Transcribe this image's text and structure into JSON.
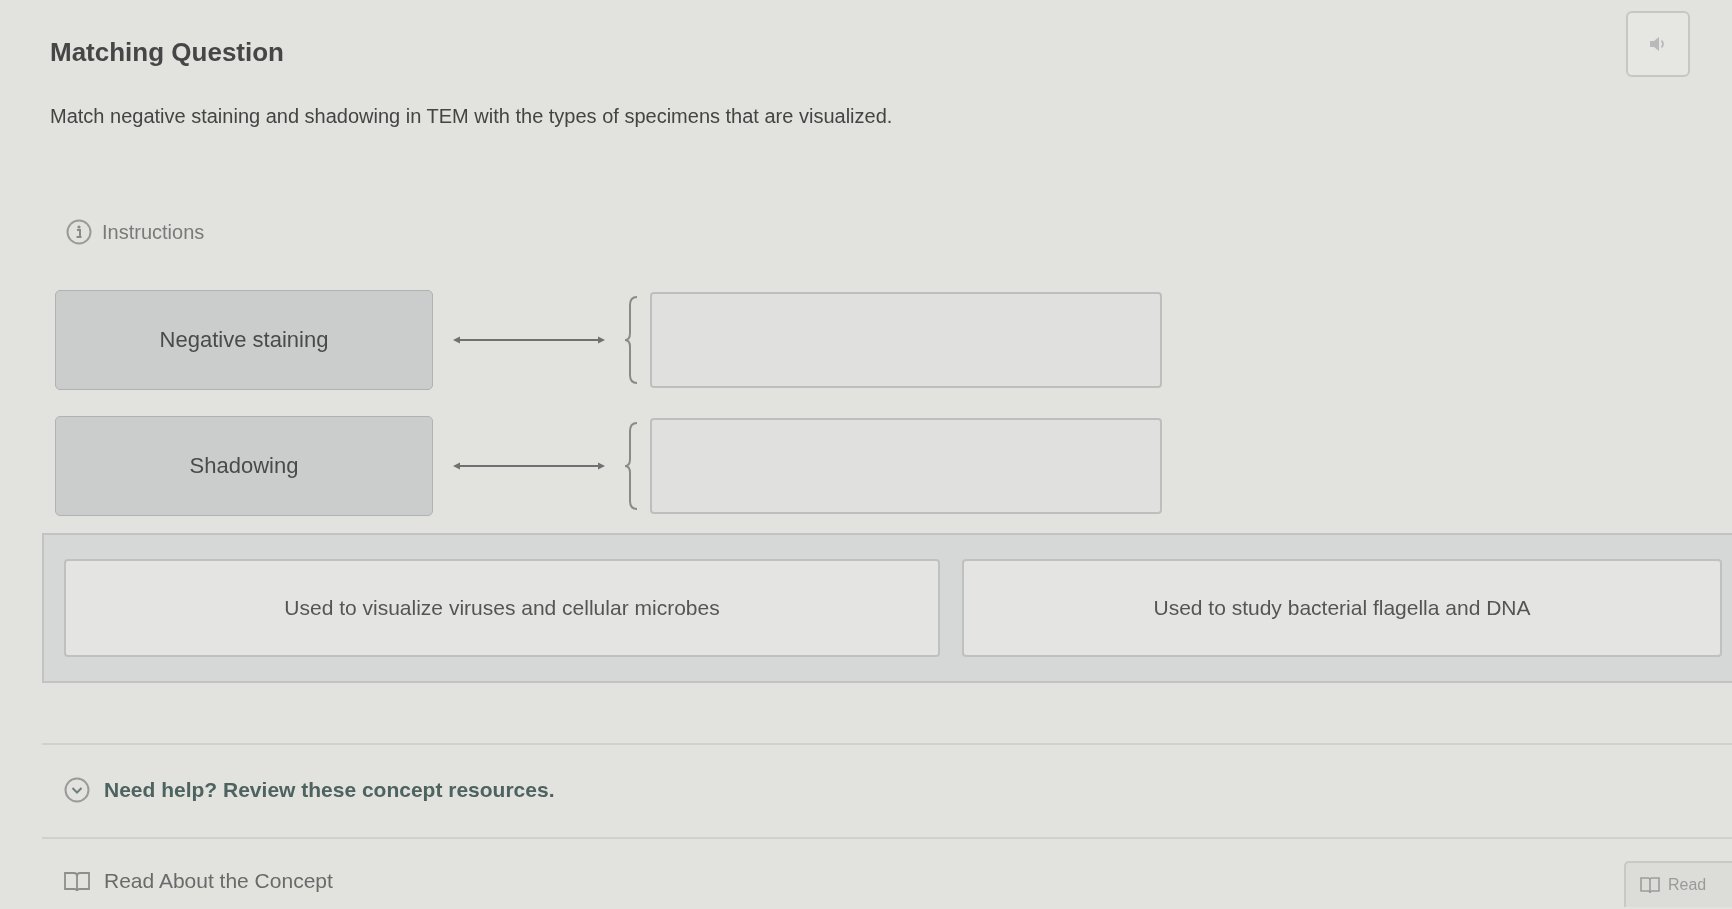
{
  "question": {
    "title": "Matching Question",
    "prompt": "Match negative staining and shadowing in TEM with the types of specimens that are visualized.",
    "instructions_label": "Instructions"
  },
  "pairs": [
    {
      "label": "Negative staining"
    },
    {
      "label": "Shadowing"
    }
  ],
  "answer_choices": [
    "Used to visualize viruses and cellular microbes",
    "Used to study bacterial flagella and DNA"
  ],
  "help": {
    "title": "Need help? Review these concept resources.",
    "resources": [
      "Read About the Concept"
    ]
  },
  "corner_button": {
    "label": "Read"
  }
}
